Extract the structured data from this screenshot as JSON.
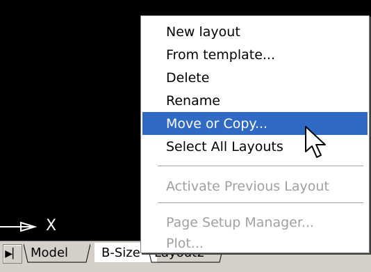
{
  "menu": {
    "items": [
      {
        "label": "New layout",
        "state": "normal"
      },
      {
        "label": "From template...",
        "state": "normal"
      },
      {
        "label": "Delete",
        "state": "normal"
      },
      {
        "label": "Rename",
        "state": "normal"
      },
      {
        "label": "Move or Copy...",
        "state": "highlighted"
      },
      {
        "label": "Select All Layouts",
        "state": "normal"
      },
      {
        "label": "Activate Previous Layout",
        "state": "disabled"
      },
      {
        "label": "Page Setup Manager...",
        "state": "disabled"
      },
      {
        "label": "Plot...",
        "state": "disabled"
      }
    ]
  },
  "tabs": {
    "nav_glyph": "▶▏",
    "items": [
      {
        "label": "Model"
      },
      {
        "label": "B-Size"
      },
      {
        "label": "Layout2"
      }
    ]
  },
  "ucs": {
    "axis_label": "X"
  },
  "colors": {
    "highlight": "#316ac5",
    "disabled_text": "#a0a0a0",
    "canvas": "#000000",
    "chrome": "#d4d0c8"
  },
  "icons": {
    "nav": "last-tab-arrow-icon",
    "cursor": "mouse-pointer-icon",
    "ucs": "ucs-axis-icon"
  }
}
